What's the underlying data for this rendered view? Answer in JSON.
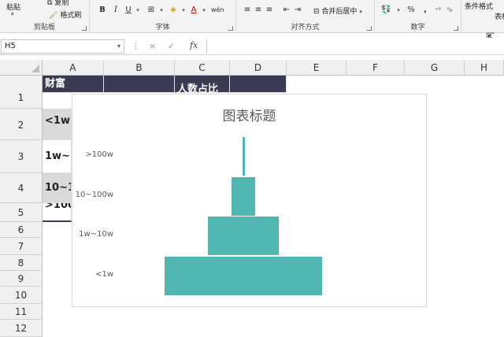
{
  "ribbon": {
    "paste": "粘贴",
    "copy": "复制",
    "format_painter": "格式刷",
    "clipboard_label": "剪贴板",
    "font_label": "字体",
    "bold": "B",
    "italic": "I",
    "underline": "U",
    "wen": "wén",
    "merge_center": "合并后居中",
    "align_label": "对齐方式",
    "percent": "%",
    "comma": ",",
    "number_label": "数字",
    "conditional_format": "条件格式",
    "table_format": "表格"
  },
  "formula_bar": {
    "name_box": "H5",
    "cancel": "×",
    "enter": "✓",
    "fx": "fx",
    "value": ""
  },
  "columns": [
    "A",
    "B",
    "C",
    "D",
    "E",
    "F",
    "G",
    "H"
  ],
  "rows": [
    "1",
    "2",
    "3",
    "4",
    "5",
    "6",
    "7",
    "8",
    "9",
    "10",
    "11",
    "12"
  ],
  "cells": {
    "a1": "财富",
    "c1": "人数占比",
    "a2": "<1w",
    "a3": "1w~1",
    "a4": "10~1",
    "a5": ">100"
  },
  "chart_data": {
    "type": "bar",
    "orientation": "horizontal",
    "title": "图表标题",
    "categories": [
      "<1w",
      "1w~10w",
      "10~100w",
      ">100w"
    ],
    "values": [
      1.0,
      0.45,
      0.15,
      0.015
    ],
    "color": "#52b7b3"
  },
  "icons": [
    "bold-icon",
    "italic-icon",
    "underline-icon",
    "border-icon",
    "fill-color-icon",
    "font-color-icon",
    "align-icon",
    "merge-icon",
    "currency-icon",
    "launcher-icon"
  ]
}
